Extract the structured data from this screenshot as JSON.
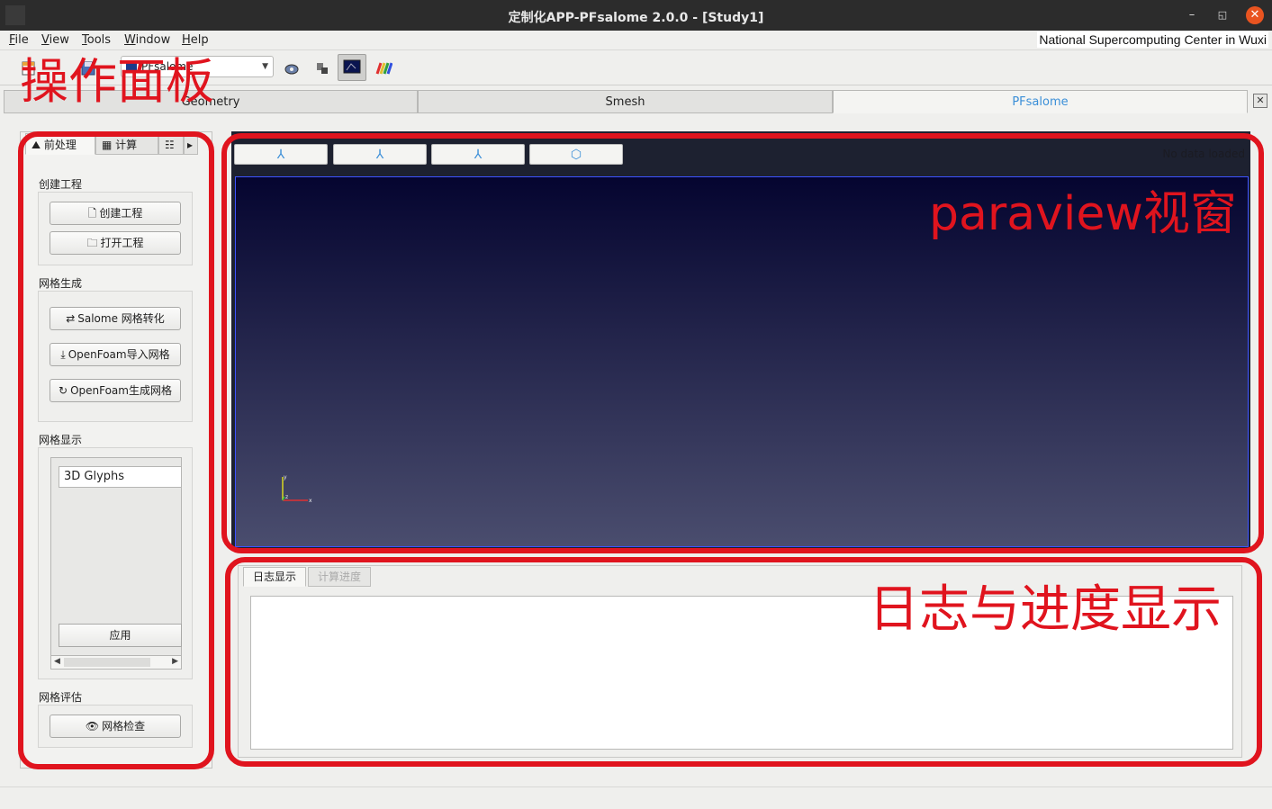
{
  "window": {
    "title": "定制化APP-PFsalome 2.0.0 - [Study1]",
    "minimize_glyph": "–",
    "restore_glyph": "◱",
    "close_glyph": "✕"
  },
  "menu": {
    "items": [
      {
        "label": "File",
        "mnemonic": "F",
        "rest": "ile"
      },
      {
        "label": "View",
        "mnemonic": "V",
        "rest": "iew"
      },
      {
        "label": "Tools",
        "mnemonic": "T",
        "rest": "ools"
      },
      {
        "label": "Window",
        "mnemonic": "W",
        "rest": "indow"
      },
      {
        "label": "Help",
        "mnemonic": "H",
        "rest": "elp"
      }
    ],
    "organization": "National Supercomputing Center in Wuxi"
  },
  "toolbar": {
    "module_combo_value": "PFsalome",
    "icons": [
      "new-study-icon",
      "save-icon",
      "paraview-icon",
      "occ-view-icon",
      "pvview-icon",
      "color-scale-icon"
    ]
  },
  "module_tabs": [
    "Geometry",
    "Smesh",
    "PFsalome"
  ],
  "active_module_tab": "PFsalome",
  "left_panel": {
    "tabs": [
      {
        "label": "前处理",
        "icon": "preprocess-icon"
      },
      {
        "label": "计算",
        "icon": "calculator-icon"
      },
      {
        "label": "",
        "icon": "postprocess-icon"
      }
    ],
    "sections": {
      "create_project": "创建工程",
      "mesh_generation": "网格生成",
      "mesh_display": "网格显示",
      "mesh_evaluation": "网格评估"
    },
    "buttons": {
      "create_project": "创建工程",
      "open_project": "打开工程",
      "salome_convert": "Salome 网格转化",
      "openfoam_import": "OpenFoam导入网格",
      "openfoam_generate": "OpenFoam生成网格",
      "mesh_check": "网格检查",
      "apply": "应用"
    },
    "glyph_list": [
      "3D Glyphs"
    ]
  },
  "paraview": {
    "view_buttons": [
      "view-x-icon",
      "view-y-icon",
      "view-z-icon",
      "view-iso-icon"
    ],
    "status": "No data loaded",
    "axes": {
      "x": "x",
      "y": "y",
      "z": "z"
    }
  },
  "log": {
    "tabs": [
      "日志显示",
      "计算进度"
    ],
    "active_tab": "日志显示",
    "content": ""
  },
  "annotations": {
    "left": "操作面板",
    "paraview": "paraview视窗",
    "log": "日志与进度显示"
  },
  "colors": {
    "annotation_red": "#e0141e",
    "active_tab_blue": "#3b8fd8",
    "view_top": "#050530",
    "view_bottom": "#4a4d6e"
  }
}
